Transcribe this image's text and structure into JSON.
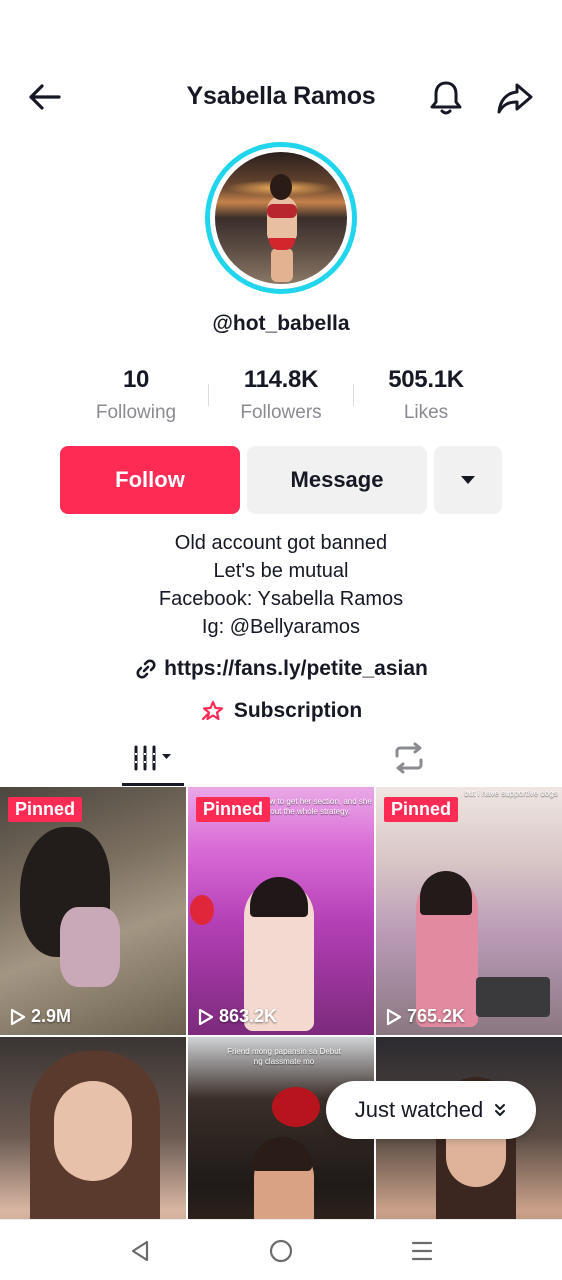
{
  "header": {
    "title": "Ysabella Ramos",
    "back_icon": "arrow-left-icon",
    "bell_icon": "bell-icon",
    "share_icon": "share-icon"
  },
  "profile": {
    "username": "@hot_babella",
    "avatar_ring_color": "#20d5ec"
  },
  "stats": {
    "following": {
      "value": "10",
      "label": "Following"
    },
    "followers": {
      "value": "114.8K",
      "label": "Followers"
    },
    "likes": {
      "value": "505.1K",
      "label": "Likes"
    }
  },
  "actions": {
    "follow_label": "Follow",
    "message_label": "Message",
    "more_icon": "caret-down-icon",
    "follow_color": "#fe2c55"
  },
  "bio": {
    "lines": [
      "Old account got banned",
      "Let's be mutual",
      "Facebook: Ysabella Ramos",
      "Ig: @Bellyaramos"
    ]
  },
  "link": {
    "text": "https://fans.ly/petite_asian",
    "icon": "link-icon"
  },
  "subscription": {
    "label": "Subscription",
    "icon": "subscription-icon"
  },
  "tabs": {
    "videos_icon": "videos-grid-icon",
    "repost_icon": "repost-icon"
  },
  "videos": [
    {
      "pinned": "Pinned",
      "views": "2.9M"
    },
    {
      "pinned": "Pinned",
      "views": "863.2K",
      "caption": "ask her how to get her section, and she lays out the whole strategy."
    },
    {
      "pinned": "Pinned",
      "views": "765.2K",
      "caption": "but i have supportive dogs"
    },
    {},
    {
      "caption": "Friend mong papansin sa Debut ng classmate mo"
    },
    {}
  ],
  "just_watched": {
    "label": "Just watched",
    "icon": "double-chevron-down-icon"
  },
  "navbar": {
    "back_icon": "nav-back-icon",
    "home_icon": "nav-home-icon",
    "menu_icon": "nav-menu-icon"
  }
}
